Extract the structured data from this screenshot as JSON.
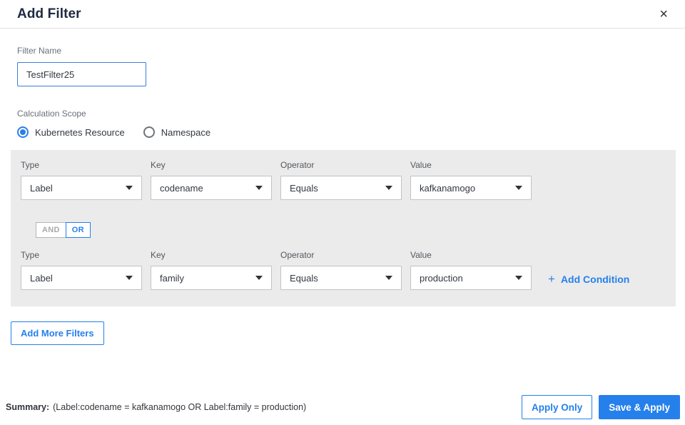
{
  "header": {
    "title": "Add Filter",
    "close_glyph": "×"
  },
  "filter_name": {
    "label": "Filter Name",
    "value": "TestFilter25"
  },
  "calculation_scope": {
    "label": "Calculation Scope",
    "options": [
      {
        "label": "Kubernetes Resource",
        "selected": true
      },
      {
        "label": "Namespace",
        "selected": false
      }
    ]
  },
  "conditions": {
    "column_labels": {
      "type": "Type",
      "key": "Key",
      "operator": "Operator",
      "value": "Value"
    },
    "rows": [
      {
        "type": "Label",
        "key": "codename",
        "operator": "Equals",
        "value": "kafkanamogo"
      },
      {
        "type": "Label",
        "key": "family",
        "operator": "Equals",
        "value": "production"
      }
    ],
    "logic_toggle": {
      "and_label": "AND",
      "or_label": "OR",
      "selected": "OR"
    },
    "add_condition": {
      "plus_glyph": "+",
      "label": "Add Condition"
    }
  },
  "buttons": {
    "add_more_filters": "Add More Filters",
    "apply_only": "Apply Only",
    "save_and_apply": "Save & Apply"
  },
  "summary": {
    "label": "Summary:",
    "text": "(Label:codename = kafkanamogo OR Label:family = production)"
  },
  "colors": {
    "accent_blue": "#2680eb",
    "radio_blue": "#2b7fe8",
    "input_border_blue": "#3a7edb",
    "panel_background": "#ebebeb",
    "title_text": "#1f2940"
  }
}
